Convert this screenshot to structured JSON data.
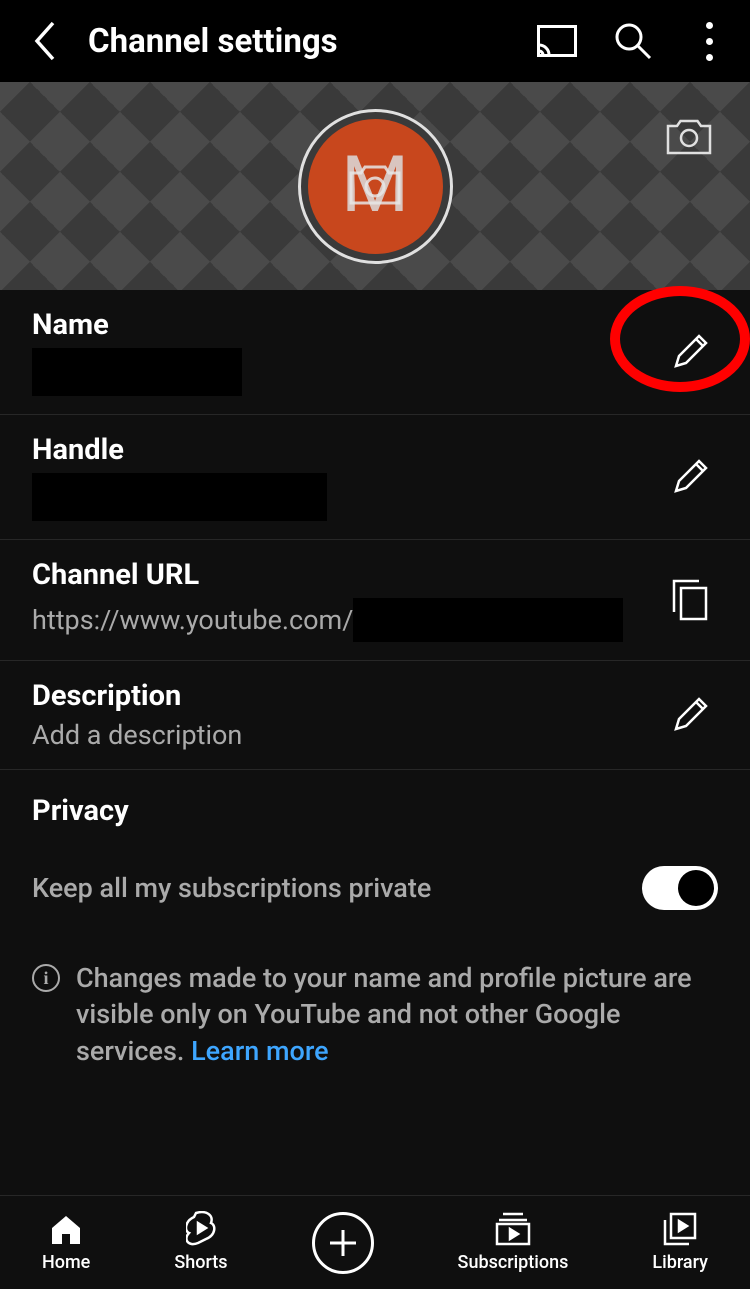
{
  "header": {
    "title": "Channel settings"
  },
  "avatar": {
    "letter": "M"
  },
  "rows": {
    "name": {
      "label": "Name"
    },
    "handle": {
      "label": "Handle"
    },
    "url": {
      "label": "Channel URL",
      "value_prefix": "https://www.youtube.com/"
    },
    "description": {
      "label": "Description",
      "placeholder": "Add a description"
    }
  },
  "privacy": {
    "section": "Privacy",
    "subs_private": "Keep all my subscriptions private",
    "toggle_on": true
  },
  "info": {
    "text": "Changes made to your name and profile picture are visible only on YouTube and not other Google services. ",
    "link": "Learn more"
  },
  "nav": {
    "home": "Home",
    "shorts": "Shorts",
    "subscriptions": "Subscriptions",
    "library": "Library"
  }
}
